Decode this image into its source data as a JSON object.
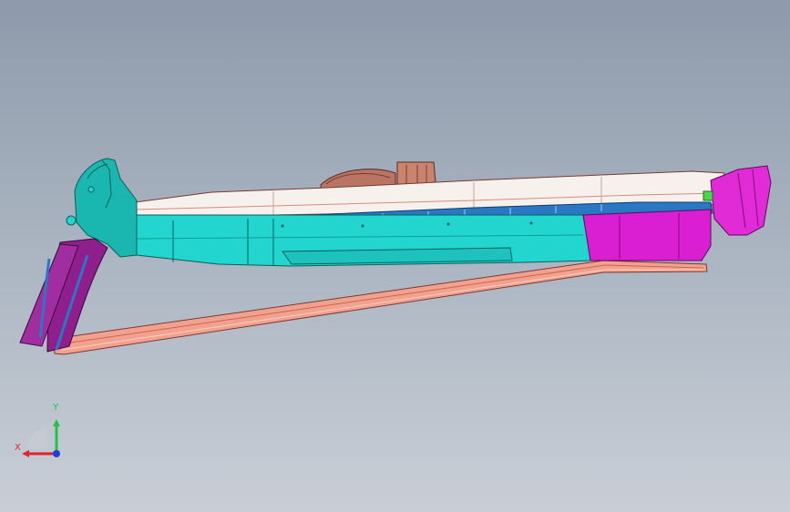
{
  "viewport": {
    "background_top": "#8e9aab",
    "background_bottom": "#c9ced6"
  },
  "model": {
    "parts": [
      {
        "name": "side-sill-panel",
        "color": "#22d6cf"
      },
      {
        "name": "rear-bracket",
        "color": "#d91fd1"
      },
      {
        "name": "front-end-cap",
        "color": "#1ab7b1"
      },
      {
        "name": "front-pillar-reinforcement",
        "color": "#8e1f8c"
      },
      {
        "name": "roof-rail-trim",
        "color": "#f7f1ee"
      },
      {
        "name": "lower-rail-beam",
        "color": "#f3a18f"
      },
      {
        "name": "inner-channel",
        "color": "#2a78c4"
      },
      {
        "name": "support-bracket",
        "color": "#b97464"
      }
    ]
  },
  "triad": {
    "x_label": "X",
    "y_label": "Y",
    "x_color": "#e0242b",
    "y_color": "#21c24a",
    "z_color": "#1f3fd6"
  }
}
